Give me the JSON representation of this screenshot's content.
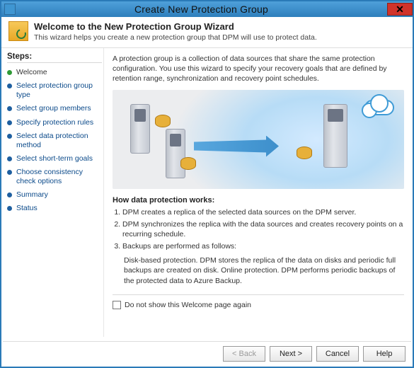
{
  "window": {
    "title": "Create New Protection Group"
  },
  "header": {
    "title": "Welcome to the New Protection Group Wizard",
    "subtitle": "This wizard helps you create a new protection group that DPM will use to protect data."
  },
  "steps_title": "Steps:",
  "steps": [
    {
      "label": "Welcome",
      "current": true
    },
    {
      "label": "Select protection group type",
      "current": false
    },
    {
      "label": "Select group members",
      "current": false
    },
    {
      "label": "Specify protection rules",
      "current": false
    },
    {
      "label": "Select data protection method",
      "current": false
    },
    {
      "label": "Select short-term goals",
      "current": false
    },
    {
      "label": "Choose consistency check options",
      "current": false
    },
    {
      "label": "Summary",
      "current": false
    },
    {
      "label": "Status",
      "current": false
    }
  ],
  "content": {
    "intro": "A protection group is a collection of data sources that share the same protection configuration. You use this wizard to specify your recovery goals that are defined by retention range, synchronization and recovery point schedules.",
    "how_heading": "How data protection works:",
    "how_items": [
      "DPM creates a replica of the selected data sources on the DPM server.",
      "DPM synchronizes the replica with the data sources and creates recovery points on a recurring schedule.",
      "Backups are performed as follows:"
    ],
    "backup_detail": "Disk-based protection. DPM stores the replica of the data on disks and periodic full backups are created on disk. Online protection. DPM performs periodic backups of the protected data to Azure Backup.",
    "checkbox_label": "Do not show this Welcome page again",
    "checkbox_checked": false
  },
  "buttons": {
    "back": "< Back",
    "next": "Next >",
    "cancel": "Cancel",
    "help": "Help"
  }
}
